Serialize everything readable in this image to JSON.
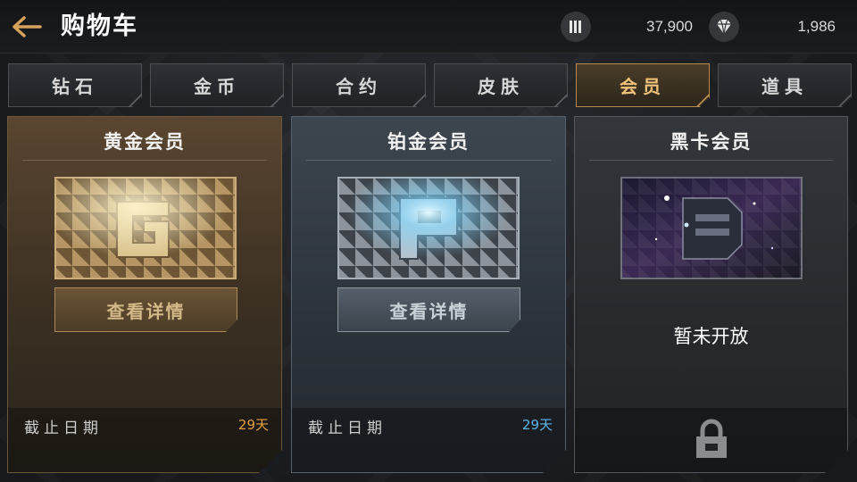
{
  "header": {
    "title": "购物车",
    "coins": "37,900",
    "diamonds": "1,986"
  },
  "tabs": [
    {
      "label": "钻石",
      "active": false
    },
    {
      "label": "金币",
      "active": false
    },
    {
      "label": "合约",
      "active": false
    },
    {
      "label": "皮肤",
      "active": false
    },
    {
      "label": "会员",
      "active": true
    },
    {
      "label": "道具",
      "active": false
    }
  ],
  "cards": [
    {
      "title": "黄金会员",
      "button": "查看详情",
      "footer_label": "截止日期",
      "days": "29天"
    },
    {
      "title": "铂金会员",
      "button": "查看详情",
      "footer_label": "截止日期",
      "days": "29天"
    },
    {
      "title": "黑卡会员",
      "status": "暂未开放"
    }
  ],
  "icons": {
    "back": "back-arrow-icon",
    "coins": "coin-stack-icon",
    "diamonds": "diamond-icon",
    "lock": "lock-icon"
  },
  "colors": {
    "accent_gold": "#f0c27a",
    "days_gold": "#e4a040",
    "days_blue": "#5cb6e8"
  }
}
